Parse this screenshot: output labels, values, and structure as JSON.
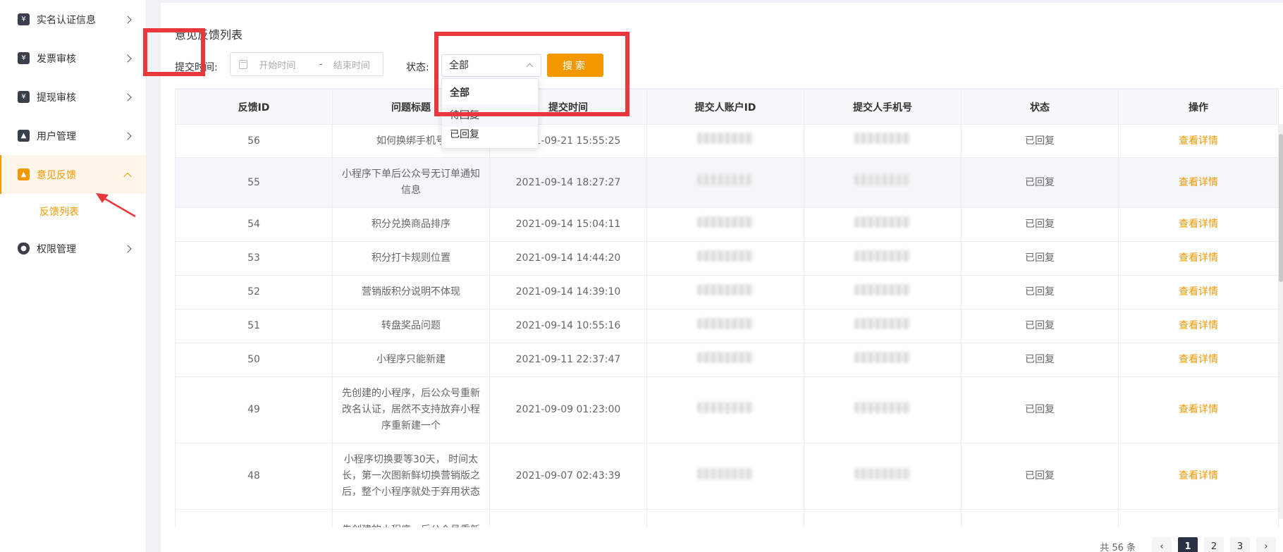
{
  "sidebar": {
    "items": [
      {
        "label": "实名认证信息",
        "icon": "yen-icon",
        "glyph": "¥"
      },
      {
        "label": "发票审核",
        "icon": "yen-icon",
        "glyph": "¥"
      },
      {
        "label": "提现审核",
        "icon": "yen-icon",
        "glyph": "¥"
      },
      {
        "label": "用户管理",
        "icon": "user-icon",
        "glyph": "▲"
      },
      {
        "label": "意见反馈",
        "icon": "feedback-icon",
        "glyph": "▲"
      },
      {
        "label": "权限管理",
        "icon": "shield-icon",
        "glyph": "●"
      }
    ],
    "sub_item": "反馈列表",
    "active_color": "#f39800"
  },
  "filters": {
    "title": "意见反馈列表",
    "submit_time_label": "提交时间:",
    "start_placeholder": "开始时间",
    "range_separator": "-",
    "end_placeholder": "结束时间",
    "status_label": "状态:",
    "status_value": "全部",
    "search_label": "搜索",
    "status_options": [
      "全部",
      "待回复",
      "已回复"
    ]
  },
  "table": {
    "headers": [
      "反馈ID",
      "问题标题",
      "提交时间",
      "提交人账户ID",
      "提交人手机号",
      "状态",
      "操作"
    ],
    "rows": [
      {
        "id": "56",
        "title": "如何换绑手机号",
        "time": "2021-09-21 15:55:25",
        "status": "已回复",
        "action": "查看详情"
      },
      {
        "id": "55",
        "title": "小程序下单后公众号无订单通知信息",
        "time": "2021-09-14 18:27:27",
        "status": "已回复",
        "action": "查看详情"
      },
      {
        "id": "54",
        "title": "积分兑换商品排序",
        "time": "2021-09-14 15:04:11",
        "status": "已回复",
        "action": "查看详情"
      },
      {
        "id": "53",
        "title": "积分打卡规则位置",
        "time": "2021-09-14 14:44:20",
        "status": "已回复",
        "action": "查看详情"
      },
      {
        "id": "52",
        "title": "营销版积分说明不体现",
        "time": "2021-09-14 14:39:10",
        "status": "已回复",
        "action": "查看详情"
      },
      {
        "id": "51",
        "title": "转盘奖品问题",
        "time": "2021-09-14 10:55:16",
        "status": "已回复",
        "action": "查看详情"
      },
      {
        "id": "50",
        "title": "小程序只能新建",
        "time": "2021-09-11 22:37:47",
        "status": "已回复",
        "action": "查看详情"
      },
      {
        "id": "49",
        "title": "先创建的小程序，后公众号重新改名认证，居然不支持放弃小程序重新建一个",
        "time": "2021-09-09 01:23:00",
        "status": "已回复",
        "action": "查看详情"
      },
      {
        "id": "48",
        "title": "小程序切换要等30天， 时间太长，第一次图新鲜切换营销版之后，整个小程序就处于弃用状态",
        "time": "2021-09-07 02:43:39",
        "status": "已回复",
        "action": "查看详情"
      },
      {
        "id": "",
        "title": "先创建的小程序，后公众号重新",
        "time": "",
        "status": "",
        "action": ""
      }
    ]
  },
  "pagination": {
    "total": "共 56 条",
    "pages": [
      "1",
      "2",
      "3"
    ],
    "current": "1",
    "prev": "‹",
    "next": "›"
  }
}
